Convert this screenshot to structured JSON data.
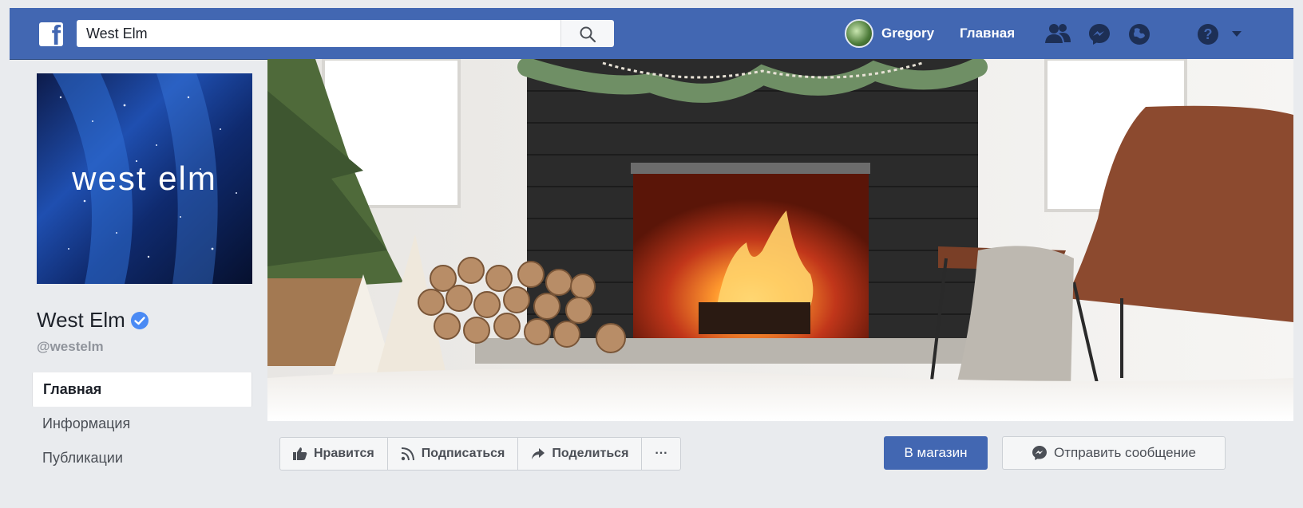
{
  "topbar": {
    "logo": "f",
    "search_value": "West Elm",
    "search_icon": "search-icon",
    "username": "Gregory",
    "home_label": "Главная",
    "icons": [
      "friends-icon",
      "messenger-icon",
      "globe-icon",
      "help-icon",
      "chevron-down-icon"
    ],
    "brand_color": "#4267b2"
  },
  "page": {
    "profile_text": "west elm",
    "name": "West Elm",
    "handle": "@westelm",
    "nav": [
      {
        "label": "Главная",
        "active": true
      },
      {
        "label": "Информация",
        "active": false
      },
      {
        "label": "Публикации",
        "active": false
      }
    ]
  },
  "actions": {
    "like": "Нравится",
    "follow": "Подписаться",
    "share": "Поделиться",
    "more": "···",
    "shop": "В магазин",
    "message": "Отправить сообщение"
  }
}
